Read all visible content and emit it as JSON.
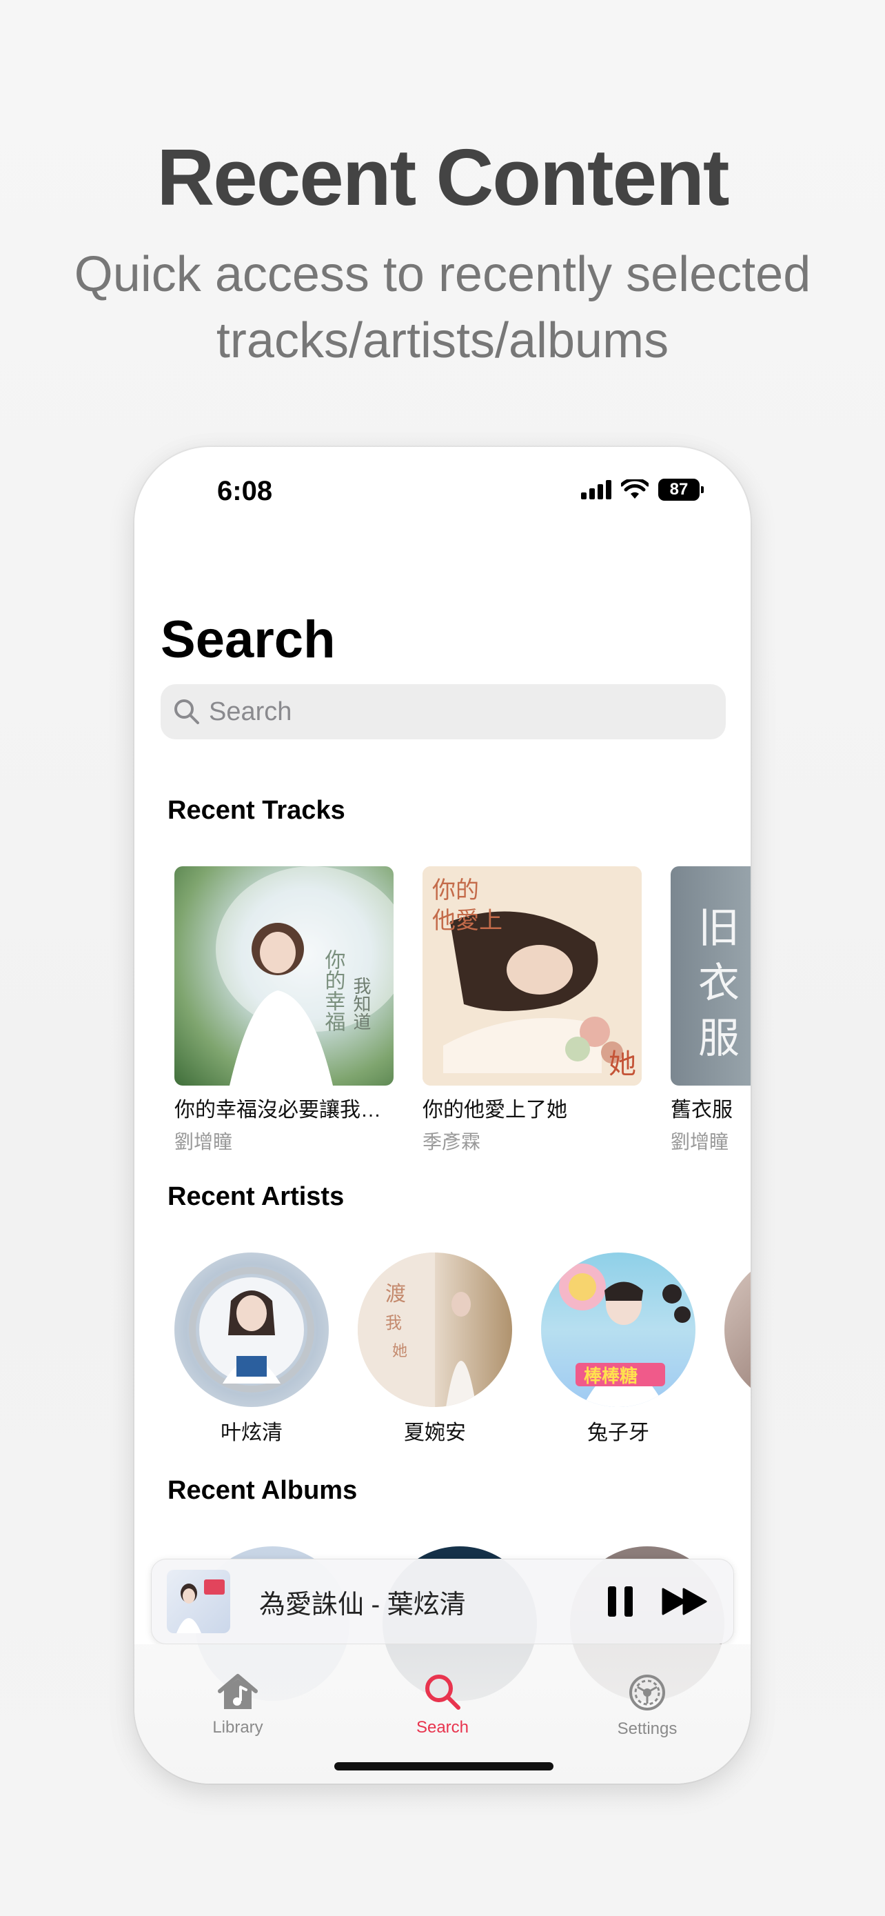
{
  "promo": {
    "headline": "Recent Content",
    "subline": "Quick access to recently selected tracks/artists/albums"
  },
  "status_bar": {
    "time": "6:08",
    "battery": "87"
  },
  "page": {
    "title": "Search"
  },
  "search": {
    "placeholder": "Search"
  },
  "sections": {
    "recent_tracks": "Recent Tracks",
    "recent_artists": "Recent Artists",
    "recent_albums": "Recent Albums"
  },
  "tracks": [
    {
      "title": "你的幸福沒必要讓我…",
      "artist": "劉增瞳"
    },
    {
      "title": "你的他愛上了她",
      "artist": "季彥霖"
    },
    {
      "title": "舊衣服",
      "artist": "劉增瞳"
    }
  ],
  "artists": [
    {
      "name": "叶炫清"
    },
    {
      "name": "夏婉安"
    },
    {
      "name": "兔子牙"
    }
  ],
  "now_playing": {
    "title": "為愛誅仙 - 葉炫清"
  },
  "tabs": [
    {
      "label": "Library",
      "icon": "library-icon"
    },
    {
      "label": "Search",
      "icon": "search-icon"
    },
    {
      "label": "Settings",
      "icon": "settings-gear-icon"
    }
  ],
  "colors": {
    "accent": "#e8344e",
    "tab_inactive": "#8a8a8a"
  }
}
